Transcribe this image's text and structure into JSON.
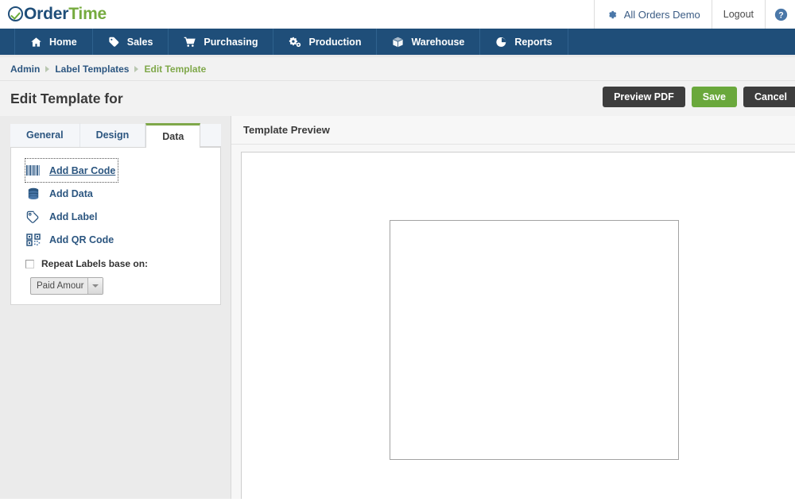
{
  "app": {
    "logo_order": "Order",
    "logo_time": "Time",
    "logo_icon": "check-circle-icon"
  },
  "topbar": {
    "gear_icon": "gear-icon",
    "account": "All Orders Demo",
    "logout": "Logout",
    "help_icon": "help-circle-icon"
  },
  "nav": {
    "items": [
      {
        "label": "Home",
        "icon": "home-icon"
      },
      {
        "label": "Sales",
        "icon": "tag-icon"
      },
      {
        "label": "Purchasing",
        "icon": "cart-icon"
      },
      {
        "label": "Production",
        "icon": "gears-icon"
      },
      {
        "label": "Warehouse",
        "icon": "box-icon"
      },
      {
        "label": "Reports",
        "icon": "pie-chart-icon"
      }
    ]
  },
  "breadcrumb": {
    "items": [
      {
        "label": "Admin",
        "current": false
      },
      {
        "label": "Label Templates",
        "current": false
      },
      {
        "label": "Edit Template",
        "current": true
      }
    ]
  },
  "header": {
    "title": "Edit Template for",
    "buttons": {
      "preview": "Preview PDF",
      "save": "Save",
      "cancel": "Cancel"
    }
  },
  "tabs": [
    {
      "label": "General",
      "active": false
    },
    {
      "label": "Design",
      "active": false
    },
    {
      "label": "Data",
      "active": true
    }
  ],
  "data_tab": {
    "tools": [
      {
        "label": "Add Bar Code",
        "icon": "barcode-icon",
        "focused": true
      },
      {
        "label": "Add Data",
        "icon": "database-icon",
        "focused": false
      },
      {
        "label": "Add Label",
        "icon": "tag-icon",
        "focused": false
      },
      {
        "label": "Add QR Code",
        "icon": "qr-code-icon",
        "focused": false
      }
    ],
    "repeat": {
      "label": "Repeat Labels base on:",
      "checked": false,
      "select_value": "Paid Amour"
    }
  },
  "preview": {
    "title": "Template Preview"
  },
  "colors": {
    "nav_blue": "#1f4e79",
    "accent_green": "#7fa84a",
    "save_green": "#6aa83c",
    "link_blue": "#2c5680",
    "button_dark": "#3d3d3d"
  }
}
